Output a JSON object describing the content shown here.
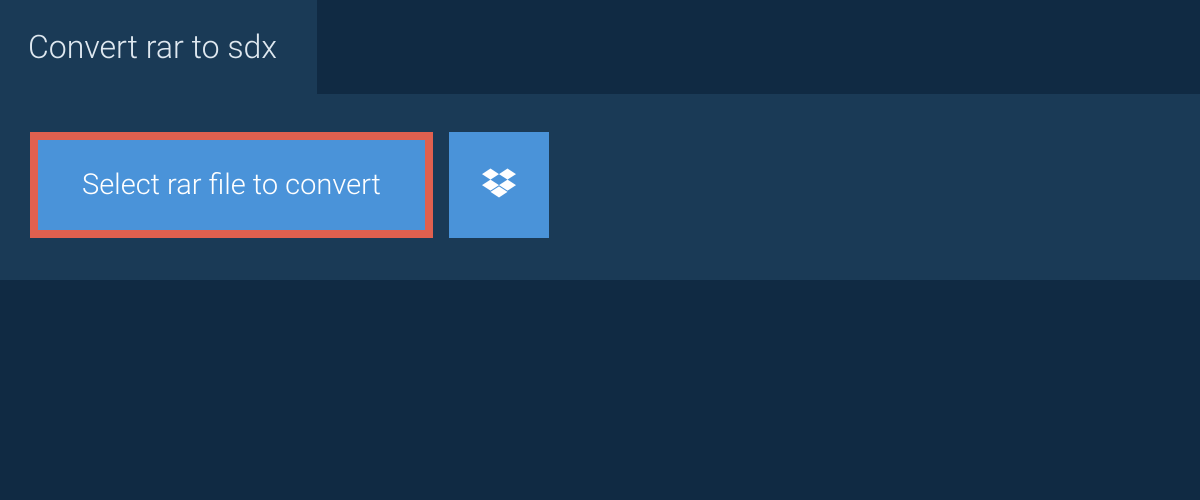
{
  "tab": {
    "title": "Convert rar to sdx"
  },
  "actions": {
    "select_file_label": "Select rar file to convert"
  },
  "colors": {
    "background_dark": "#102a43",
    "panel": "#1a3a56",
    "button_blue": "#4a93d9",
    "highlight_border": "#e0604f",
    "text_light": "#dfe8f0"
  }
}
